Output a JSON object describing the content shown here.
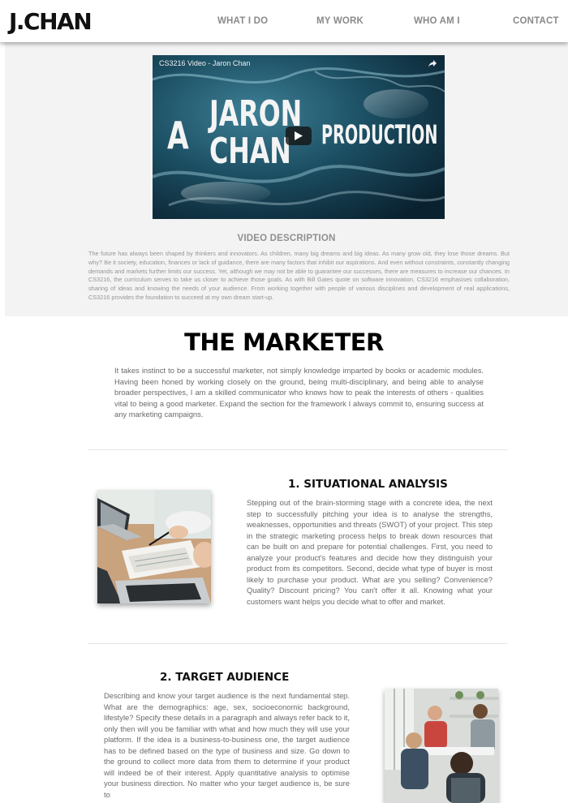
{
  "header": {
    "logo": "J.CHAN",
    "nav": [
      {
        "label": "WHAT I DO"
      },
      {
        "label": "MY WORK"
      },
      {
        "label": "WHO AM I"
      },
      {
        "label": "CONTACT"
      }
    ]
  },
  "video": {
    "title": "CS3216 Video - Jaron Chan",
    "overlay_a": "A",
    "overlay_jaron": "JARON",
    "overlay_chan": "CHAN",
    "overlay_production": "PRODUCTION",
    "description_heading": "VIDEO DESCRIPTION",
    "description": "The future has always been shaped by thinkers and innovators. As children, many big dreams and big ideas. As many grow old, they lose those dreams. But why? Be it society, education, finances or lack of guidance, there are many factors that inhibit our aspirations. And even without constraints, constantly changing demands and markets further limits our success. Yet, although we may not be able to guarantee our successes, there are measures to increase our chances. In CS3216, the curriculum serves to take us closer to achieve those goals. As with Bill Gates quote on software innovation, CS3216 emphasises collaboration, sharing of ideas and knowing the needs of your audience. From working together with people of various disciplines and development of real applications, CS3216 provides the foundation to succeed at my own dream start-up."
  },
  "marketer": {
    "title": "THE MARKETER",
    "intro": "It takes instinct to be a successful marketer, not simply knowledge imparted by books or academic modules. Having been honed by working closely on the ground, being multi-disciplinary, and being able to analyse broader perspectives, I am a skilled communicator who knows how to peak the interests of others - qualities vital to being a good marketer. Expand the section for the framework I always commit to, ensuring success at any marketing campaigns."
  },
  "sections": [
    {
      "title": "1. SITUATIONAL ANALYSIS",
      "text": "Stepping out of the brain-storming stage with a concrete idea, the next step to successfully pitching your idea is to analyse the strengths, weaknesses, opportunities and threats (SWOT) of your project. This step in the strategic marketing process helps to break down resources that can be built on and prepare for potential challenges. First, you need to analyze your product's features and decide how they distinguish your product from its competitors. Second, decide what type of buyer is most likely to purchase your product. What are you selling? Convenience? Quality? Discount pricing? You can't offer it all. Knowing what your customers want helps you decide what to offer and market."
    },
    {
      "title": "2. TARGET AUDIENCE",
      "text": "Describing and know your target audience is the next fundamental step. What are the demographics: age, sex, socioeconomic background, lifestyle? Specify these details in a paragraph and always refer back to it, only then will you be familiar with what and how much they will use your platform. If the idea is a business-to-business one, the target audience has to be defined based on the type of business and size. Go down to the ground to collect more data from them to determine if your product will indeed be of their interest. Apply quantitative analysis to optimise your business direction. No matter who your target audience is, be sure to"
    }
  ]
}
